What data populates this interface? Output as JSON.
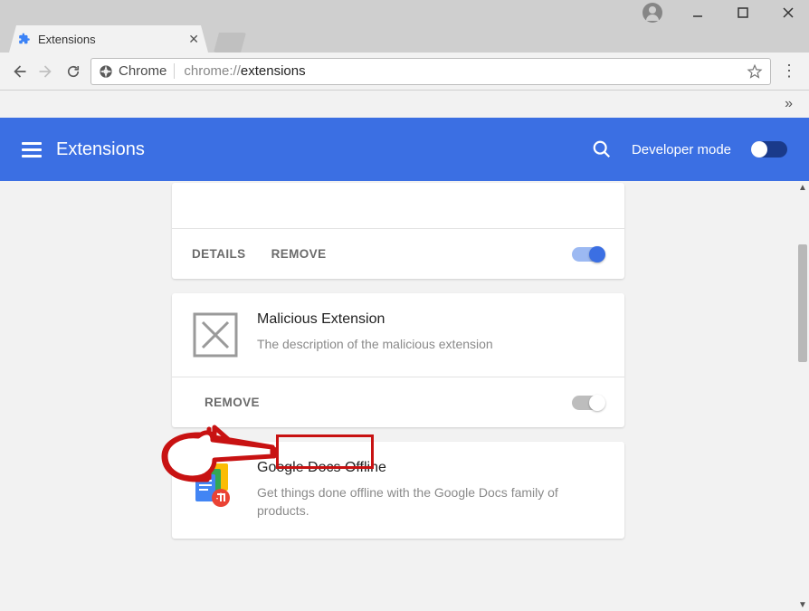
{
  "window_controls": {
    "minimize": "—",
    "maximize": "▢",
    "close": "✕"
  },
  "tab": {
    "title": "Extensions",
    "close": "✕"
  },
  "omnibox": {
    "origin": "Chrome",
    "url_prefix": "chrome://",
    "url_bold": "extensions"
  },
  "overflow_glyph": "»",
  "ext_bar": {
    "title": "Extensions",
    "dev_label": "Developer mode"
  },
  "cards": [
    {
      "details": "DETAILS",
      "remove": "REMOVE",
      "enabled": true
    },
    {
      "name": "Malicious Extension",
      "desc": "The description of the malicious extension",
      "remove": "REMOVE",
      "enabled": false
    },
    {
      "name": "Google Docs Offline",
      "desc": "Get things done offline with the Google Docs family of products."
    }
  ]
}
